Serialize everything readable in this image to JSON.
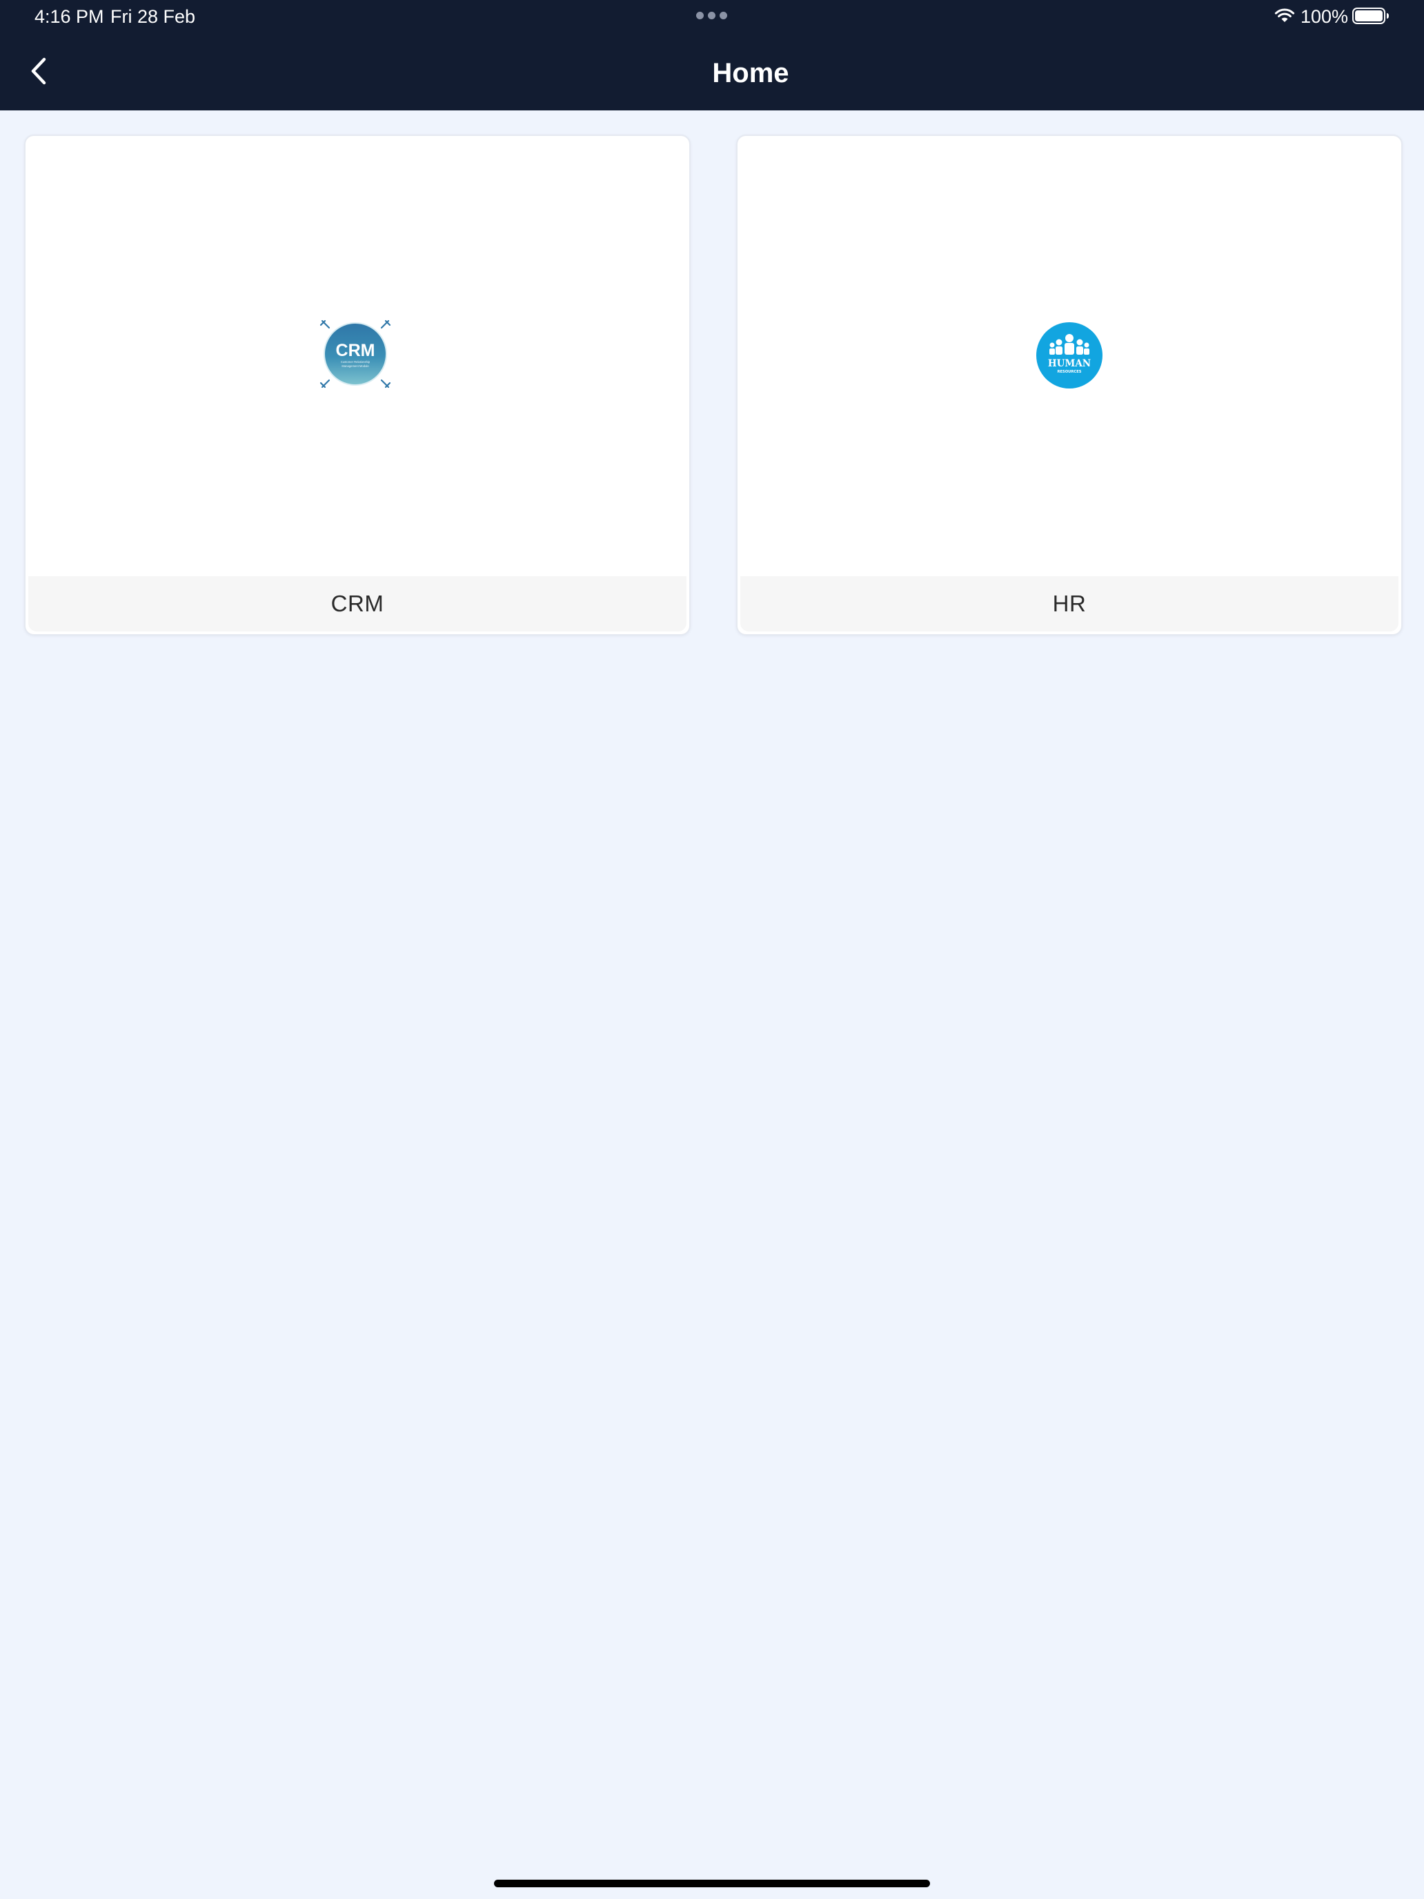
{
  "status_bar": {
    "time": "4:16 PM",
    "date": "Fri 28 Feb",
    "battery": "100%"
  },
  "header": {
    "title": "Home",
    "back_icon": "chevron-left-icon"
  },
  "apps": [
    {
      "label": "CRM",
      "logo_text": "CRM",
      "logo_subtext": "Customer Relationship Management Module",
      "icon": "crm-logo-icon"
    },
    {
      "label": "HR",
      "logo_text": "HUMAN",
      "logo_subtext": "RESOURCES",
      "icon": "hr-logo-icon"
    }
  ],
  "colors": {
    "header_bg": "#121c31",
    "page_bg": "#eff4fd",
    "card_label_bg": "#f6f6f6",
    "crm_logo": "#2e86ab",
    "hr_logo": "#12a5e0"
  }
}
